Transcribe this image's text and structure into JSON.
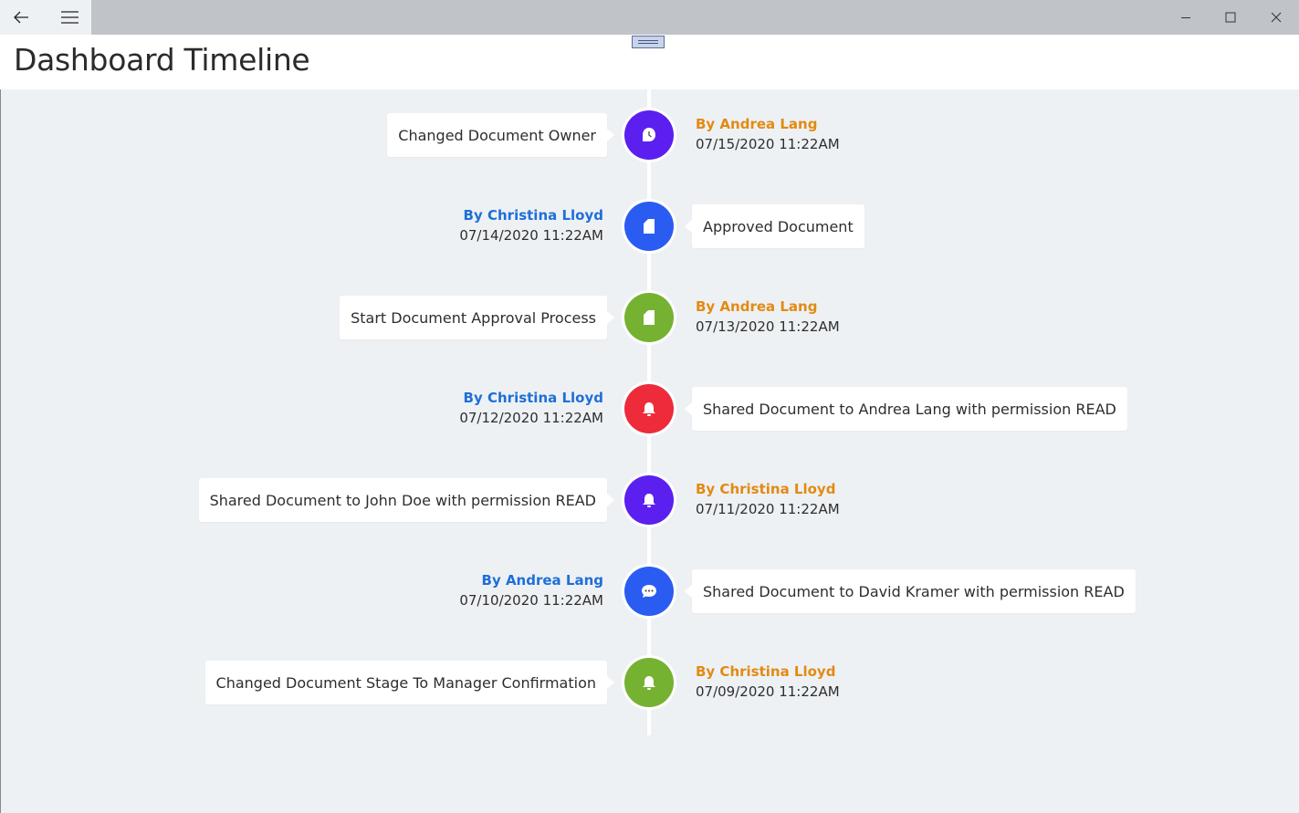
{
  "window": {
    "back_icon": "back-arrow-icon",
    "menu_icon": "hamburger-icon",
    "minimize_icon": "minimize-icon",
    "maximize_icon": "maximize-icon",
    "close_icon": "close-icon"
  },
  "header": {
    "title": "Dashboard Timeline"
  },
  "colors": {
    "purple": "#5b1ff0",
    "blue": "#2b5cf2",
    "green": "#75b231",
    "red": "#ee2b3b",
    "author_orange": "#e38a12",
    "author_blue": "#1e6fd8",
    "background": "#eef1f4"
  },
  "timeline": [
    {
      "text": "Changed Document Owner",
      "author": "By Andrea Lang",
      "time": "07/15/2020 11:22AM",
      "color": "#5b1ff0",
      "icon": "clock-icon",
      "author_color": "orange"
    },
    {
      "text": "Approved Document",
      "author": "By Christina Lloyd",
      "time": "07/14/2020 11:22AM",
      "color": "#2b5cf2",
      "icon": "document-icon",
      "author_color": "blue"
    },
    {
      "text": "Start Document Approval Process",
      "author": "By Andrea Lang",
      "time": "07/13/2020 11:22AM",
      "color": "#75b231",
      "icon": "document-icon",
      "author_color": "orange"
    },
    {
      "text": "Shared Document to Andrea Lang with permission READ",
      "author": "By Christina Lloyd",
      "time": "07/12/2020 11:22AM",
      "color": "#ee2b3b",
      "icon": "bell-icon",
      "author_color": "blue"
    },
    {
      "text": "Shared Document to John Doe with permission READ",
      "author": "By Christina Lloyd",
      "time": "07/11/2020 11:22AM",
      "color": "#5b1ff0",
      "icon": "bell-icon",
      "author_color": "orange"
    },
    {
      "text": "Shared Document to David Kramer with permission READ",
      "author": "By Andrea Lang",
      "time": "07/10/2020 11:22AM",
      "color": "#2b5cf2",
      "icon": "chat-bubble-icon",
      "author_color": "blue"
    },
    {
      "text": "Changed Document Stage To Manager Confirmation",
      "author": "By Christina Lloyd",
      "time": "07/09/2020 11:22AM",
      "color": "#75b231",
      "icon": "bell-icon",
      "author_color": "orange"
    }
  ]
}
